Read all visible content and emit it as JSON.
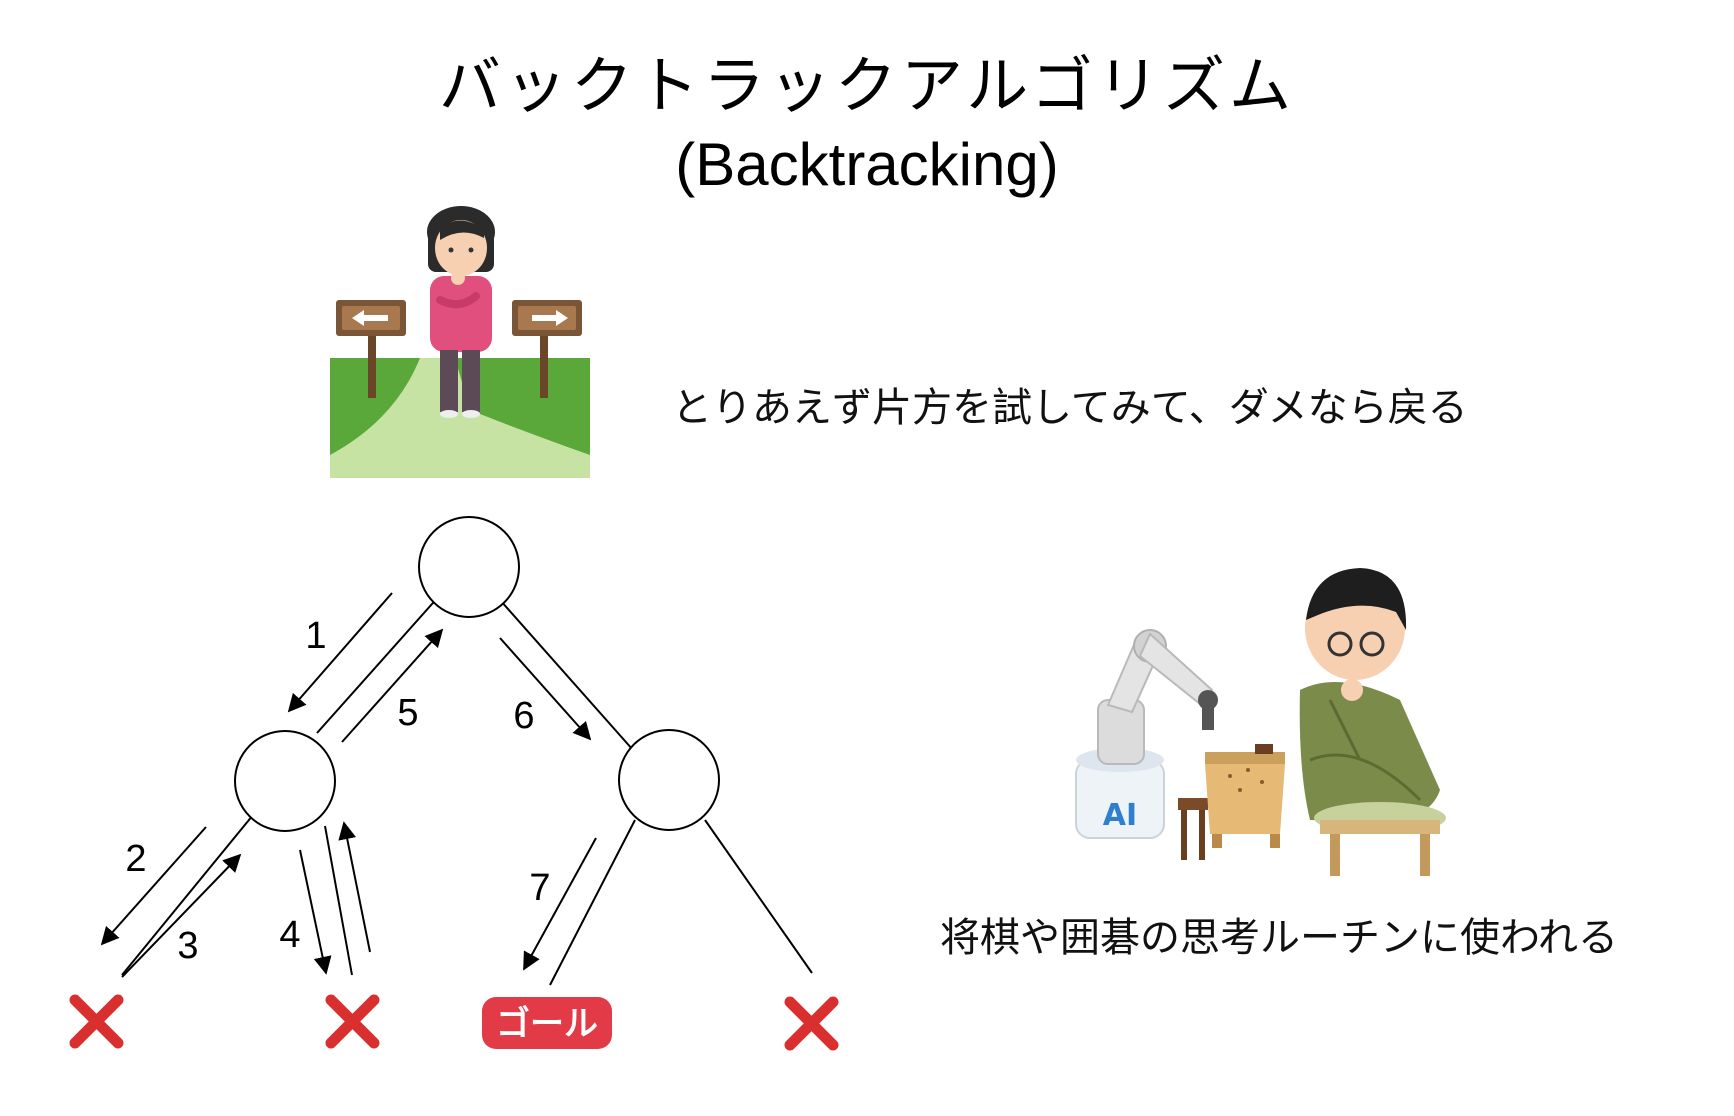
{
  "title": {
    "japanese": "バックトラックアルゴリズム",
    "english": "(Backtracking)"
  },
  "captions": {
    "crossroads": "とりあえず片方を試してみて、ダメなら戻る",
    "shogi": "将棋や囲碁の思考ルーチンに使われる"
  },
  "tree": {
    "step_labels": [
      "1",
      "2",
      "3",
      "4",
      "5",
      "6",
      "7"
    ],
    "goal_label": "ゴール",
    "fail_mark": "✕"
  },
  "robot": {
    "label": "AI"
  },
  "colors": {
    "fail_red": "#d9302f",
    "goal_red": "#e23b47",
    "grass_dark": "#5aa83a",
    "grass_light": "#c6e3a3",
    "sign_brown": "#7a5536",
    "shirt_pink": "#e14f7e",
    "kimono_green": "#7b8c4a",
    "board_wood": "#e6b974",
    "robot_grey": "#dcdcdc",
    "ai_blue": "#2f7fd0"
  }
}
